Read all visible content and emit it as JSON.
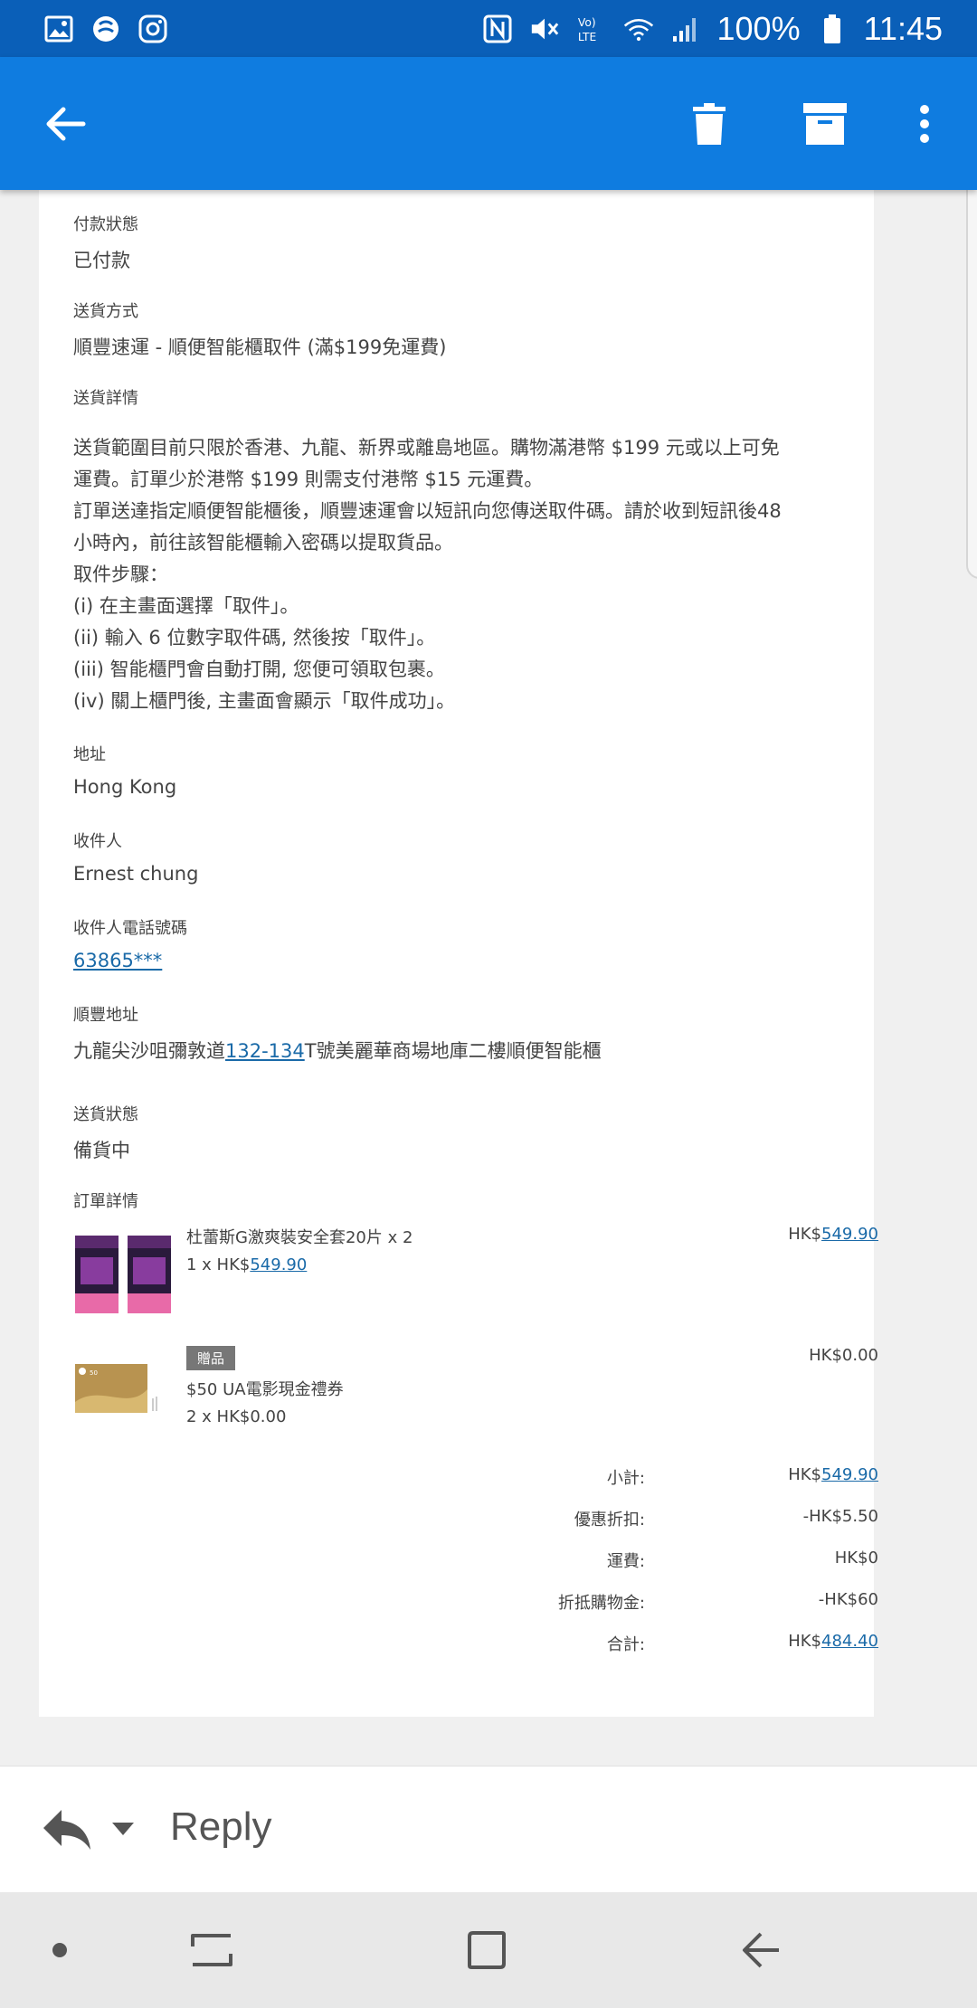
{
  "status_bar": {
    "battery": "100%",
    "time": "11:45"
  },
  "email": {
    "payment_status_label": "付款狀態",
    "payment_status_value": "已付款",
    "shipping_method_label": "送貨方式",
    "shipping_method_value": "順豐速運 - 順便智能櫃取件 (滿$199免運費)",
    "shipping_details_label": "送貨詳情",
    "shipping_details_lines": [
      "送貨範圍目前只限於香港、九龍、新界或離島地區。購物滿港幣 $199 元或以上可免",
      "運費。訂單少於港幣 $199 則需支付港幣 $15 元運費。",
      "訂單送達指定順便智能櫃後，順豐速運會以短訊向您傳送取件碼。請於收到短訊後48",
      "小時內，前往該智能櫃輸入密碼以提取貨品。",
      "取件步驟：",
      "(i) 在主畫面選擇「取件」。",
      "(ii) 輸入 6 位數字取件碼, 然後按「取件」。",
      "(iii) 智能櫃門會自動打開, 您便可領取包裹。",
      "(iv) 關上櫃門後, 主畫面會顯示「取件成功」。"
    ],
    "address_label": "地址",
    "address_value": "Hong Kong",
    "recipient_label": "收件人",
    "recipient_value": "Ernest chung",
    "phone_label": "收件人電話號碼",
    "phone_value": "63865***",
    "sf_address_label": "順豐地址",
    "sf_address_prefix": "九龍尖沙咀彌敦道",
    "sf_address_link": "132-134",
    "sf_address_suffix": "T號美麗華商場地庫二樓順便智能櫃",
    "delivery_status_label": "送貨狀態",
    "delivery_status_value": "備貨中",
    "order_details_label": "訂單詳情",
    "items": [
      {
        "name": "杜蕾斯G激爽裝安全套20片 x 2",
        "qty_prefix": "1 x HK$",
        "qty_price": "549.90",
        "total_prefix": "HK$",
        "total_value": "549.90"
      },
      {
        "badge": "贈品",
        "name": "$50 UA電影現金禮券",
        "qty_line": "2 x HK$0.00",
        "total": "HK$0.00"
      }
    ],
    "summary": {
      "subtotal_label": "小計:",
      "subtotal_prefix": "HK$",
      "subtotal_value": "549.90",
      "discount_label": "優惠折扣:",
      "discount_value": "-HK$5.50",
      "shipping_label": "運費:",
      "shipping_value": "HK$0",
      "credit_label": "折抵購物金:",
      "credit_value": "-HK$60",
      "total_label": "合計:",
      "total_prefix": "HK$",
      "total_value": "484.40"
    }
  },
  "reply_bar": {
    "reply_label": "Reply"
  },
  "colors": {
    "status_bar": "#0a5fb8",
    "app_bar": "#0f7ce0",
    "link": "#1a6aa8"
  },
  "icons": [
    "gallery-icon",
    "cloud-icon",
    "instagram-icon",
    "nfc-icon",
    "mute-icon",
    "volte-icon",
    "wifi-icon",
    "signal-icon",
    "battery-icon",
    "back-arrow-icon",
    "delete-icon",
    "archive-icon",
    "more-icon",
    "reply-icon",
    "dropdown-icon",
    "home-dot-icon",
    "recents-icon",
    "home-icon",
    "back-icon"
  ]
}
